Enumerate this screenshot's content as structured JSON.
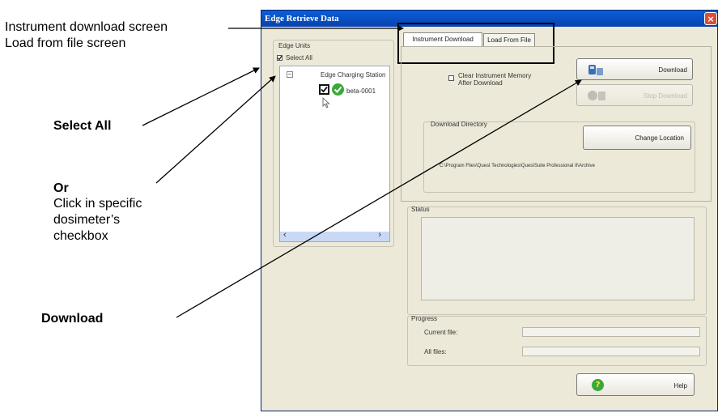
{
  "annotations": {
    "tabs_line1": "Instrument download screen",
    "tabs_line2": "Load from file screen",
    "select_all": "Select All",
    "or": "Or",
    "click_line1": "Click in specific",
    "click_line2": "dosimeter’s",
    "click_line3": "checkbox",
    "download": "Download"
  },
  "window": {
    "title": "Edge Retrieve Data",
    "close_glyph": "×"
  },
  "edge_units": {
    "label": "Edge Units",
    "select_all_label": "Select All",
    "station_label": "Edge Charging Station",
    "device_label": "beta-0001",
    "collapse_glyph": "−",
    "scroll_left": "‹",
    "scroll_right": "›"
  },
  "tabs": [
    {
      "label": "Instrument Download"
    },
    {
      "label": "Load From File"
    }
  ],
  "download_panel": {
    "clear_memory_line1": "Clear Instrument Memory",
    "clear_memory_line2": "After Download",
    "download_button": "Download",
    "disabled_button": "Stop Download",
    "directory_label": "Download Directory",
    "change_location_button": "Change Location",
    "path": "C:\\Program Files\\Quest Technologies\\QuestSuite Professional II\\Archive"
  },
  "status": {
    "label": "Status"
  },
  "progress": {
    "label": "Progress",
    "current_file_label": "Current file:",
    "all_files_label": "All files:"
  },
  "help_button": "Help",
  "colors": {
    "window_bg": "#ece9d8",
    "titlebar": "#0842b0",
    "accent_green": "#3aa83a",
    "list_selection": "#c9d8f5"
  }
}
